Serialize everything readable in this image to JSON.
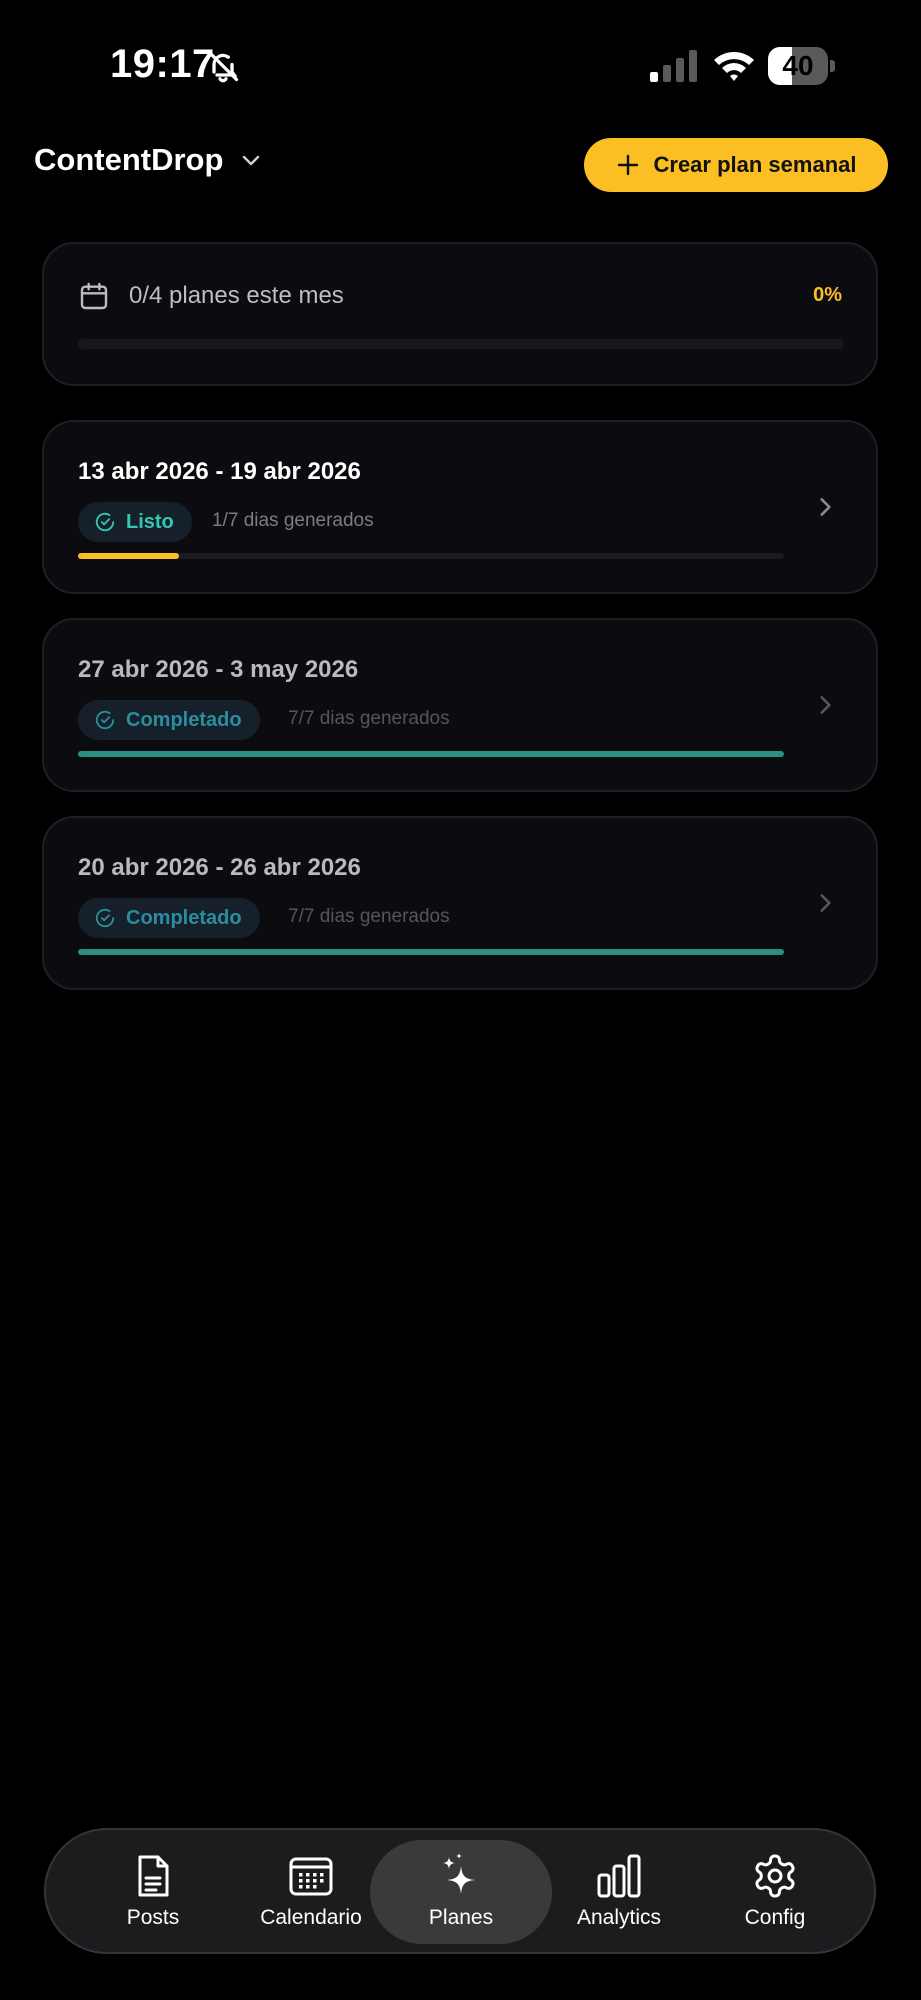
{
  "status_bar": {
    "time": "19:17",
    "battery": "40",
    "battery_level": 0.4
  },
  "header": {
    "app_name": "ContentDrop",
    "create_label": "Crear plan semanal"
  },
  "summary": {
    "text": "0/4 planes este mes",
    "percent_label": "0%",
    "progress": 0
  },
  "plans": [
    {
      "range": "13 abr 2026 - 19 abr 2026",
      "status": "Listo",
      "days": "1/7 dias generados",
      "progress": 0.142857,
      "status_color": "#34c8b4",
      "bar_color": "#fbbf24"
    },
    {
      "range": "27 abr 2026 - 3 may 2026",
      "status": "Completado",
      "days": "7/7 dias generados",
      "progress": 1,
      "status_color": "#2a8e9e",
      "bar_color": "#2a8f80"
    },
    {
      "range": "20 abr 2026 - 26 abr 2026",
      "status": "Completado",
      "days": "7/7 dias generados",
      "progress": 1,
      "status_color": "#2a8e9e",
      "bar_color": "#2a8f80"
    }
  ],
  "nav": [
    {
      "label": "Posts",
      "icon": "document-icon"
    },
    {
      "label": "Calendario",
      "icon": "calendar-grid-icon"
    },
    {
      "label": "Planes",
      "icon": "sparkles-icon",
      "active": true
    },
    {
      "label": "Analytics",
      "icon": "bar-chart-icon"
    },
    {
      "label": "Config",
      "icon": "gear-icon"
    }
  ],
  "colors": {
    "accent": "#fbbf24",
    "background": "#000000",
    "card": "#0b0b10"
  }
}
